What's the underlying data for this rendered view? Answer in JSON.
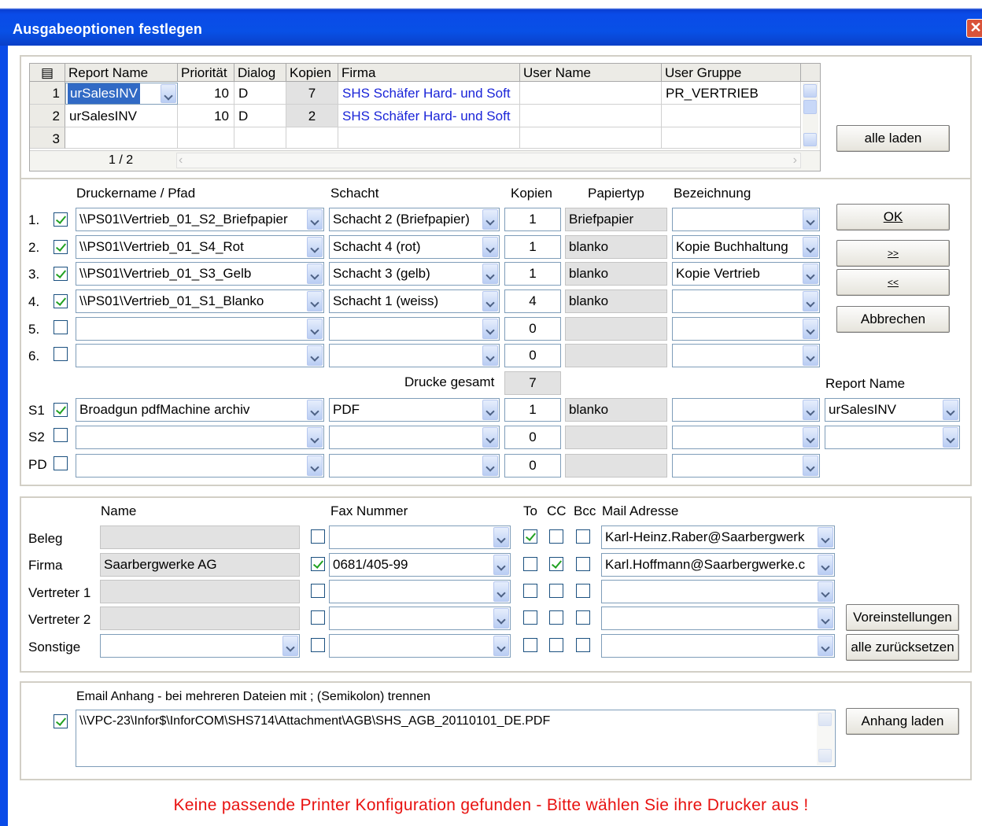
{
  "window": {
    "title": "Ausgabeoptionen festlegen"
  },
  "grid": {
    "headers": [
      "Report Name",
      "Priorität",
      "Dialog",
      "Kopien",
      "Firma",
      "User Name",
      "User Gruppe"
    ],
    "rows": [
      {
        "num": "1",
        "report": "urSalesINV",
        "prio": "10",
        "dialog": "D",
        "kopien": "7",
        "firma": "SHS Schäfer Hard- und Soft",
        "user": "",
        "gruppe": "PR_VERTRIEB"
      },
      {
        "num": "2",
        "report": "urSalesINV",
        "prio": "10",
        "dialog": "D",
        "kopien": "2",
        "firma": "SHS Schäfer Hard- und Soft",
        "user": "",
        "gruppe": ""
      },
      {
        "num": "3",
        "report": "",
        "prio": "",
        "dialog": "",
        "kopien": "",
        "firma": "",
        "user": "",
        "gruppe": ""
      }
    ],
    "pager": "1 / 2"
  },
  "buttons": {
    "alle_laden": "alle laden",
    "ok": "OK",
    "fwd": ">>",
    "back": "<<",
    "abbrechen": "Abbrechen",
    "voreinstellungen": "Voreinstellungen",
    "alle_zuruecksetzen": "alle zurücksetzen",
    "anhang_laden": "Anhang laden"
  },
  "printers": {
    "headers": {
      "name": "Druckername / Pfad",
      "schacht": "Schacht",
      "kopien": "Kopien",
      "papiertyp": "Papiertyp",
      "bezeichnung": "Bezeichnung"
    },
    "rows": [
      {
        "label": "1.",
        "checked": true,
        "name": "\\\\PS01\\Vertrieb_01_S2_Briefpapier",
        "schacht": "Schacht 2 (Briefpapier)",
        "kopien": "1",
        "papiertyp": "Briefpapier",
        "bezeichnung": ""
      },
      {
        "label": "2.",
        "checked": true,
        "name": "\\\\PS01\\Vertrieb_01_S4_Rot",
        "schacht": "Schacht 4 (rot)",
        "kopien": "1",
        "papiertyp": "blanko",
        "bezeichnung": "Kopie Buchhaltung"
      },
      {
        "label": "3.",
        "checked": true,
        "name": "\\\\PS01\\Vertrieb_01_S3_Gelb",
        "schacht": "Schacht 3 (gelb)",
        "kopien": "1",
        "papiertyp": "blanko",
        "bezeichnung": "Kopie Vertrieb"
      },
      {
        "label": "4.",
        "checked": true,
        "name": "\\\\PS01\\Vertrieb_01_S1_Blanko",
        "schacht": "Schacht 1 (weiss)",
        "kopien": "4",
        "papiertyp": "blanko",
        "bezeichnung": ""
      },
      {
        "label": "5.",
        "checked": false,
        "name": "",
        "schacht": "",
        "kopien": "0",
        "papiertyp": "",
        "bezeichnung": ""
      },
      {
        "label": "6.",
        "checked": false,
        "name": "",
        "schacht": "",
        "kopien": "0",
        "papiertyp": "",
        "bezeichnung": ""
      }
    ],
    "drucke_gesamt_label": "Drucke gesamt",
    "drucke_gesamt": "7",
    "report_name_label": "Report Name",
    "special": [
      {
        "label": "S1",
        "checked": true,
        "name": "Broadgun pdfMachine archiv",
        "schacht": "PDF",
        "kopien": "1",
        "papiertyp": "blanko",
        "bezeichnung": "",
        "report": "urSalesINV"
      },
      {
        "label": "S2",
        "checked": false,
        "name": "",
        "schacht": "",
        "kopien": "0",
        "papiertyp": "",
        "bezeichnung": "",
        "report": ""
      },
      {
        "label": "PD",
        "checked": false,
        "name": "",
        "schacht": "",
        "kopien": "0",
        "papiertyp": "",
        "bezeichnung": ""
      }
    ]
  },
  "contacts": {
    "headers": {
      "name": "Name",
      "fax": "Fax Nummer",
      "to": "To",
      "cc": "CC",
      "bcc": "Bcc",
      "mail": "Mail Adresse"
    },
    "rows": [
      {
        "label": "Beleg",
        "name": "",
        "fax_checked": false,
        "fax": "",
        "to": true,
        "cc": false,
        "bcc": false,
        "mail": "Karl-Heinz.Raber@Saarbergwerk"
      },
      {
        "label": "Firma",
        "name": "Saarbergwerke AG",
        "fax_checked": true,
        "fax": "0681/405-99",
        "to": false,
        "cc": true,
        "bcc": false,
        "mail": "Karl.Hoffmann@Saarbergwerke.c"
      },
      {
        "label": "Vertreter 1",
        "name": "",
        "fax_checked": false,
        "fax": "",
        "to": false,
        "cc": false,
        "bcc": false,
        "mail": ""
      },
      {
        "label": "Vertreter 2",
        "name": "",
        "fax_checked": false,
        "fax": "",
        "to": false,
        "cc": false,
        "bcc": false,
        "mail": ""
      },
      {
        "label": "Sonstige",
        "name": "",
        "fax_checked": false,
        "fax": "",
        "to": false,
        "cc": false,
        "bcc": false,
        "mail": ""
      }
    ]
  },
  "attachment": {
    "label": "Email Anhang - bei mehreren Dateien mit ;  (Semikolon) trennen",
    "checked": true,
    "path": "\\\\VPC-23\\Infor$\\InforCOM\\SHS714\\Attachment\\AGB\\SHS_AGB_20110101_DE.PDF"
  },
  "warning": "Keine passende Printer Konfiguration gefunden - Bitte wählen Sie ihre Drucker aus !",
  "colors": {
    "titlebar": "#0a4be8",
    "link": "#1a24d8",
    "warning": "#e8110f",
    "check": "#21a121"
  }
}
